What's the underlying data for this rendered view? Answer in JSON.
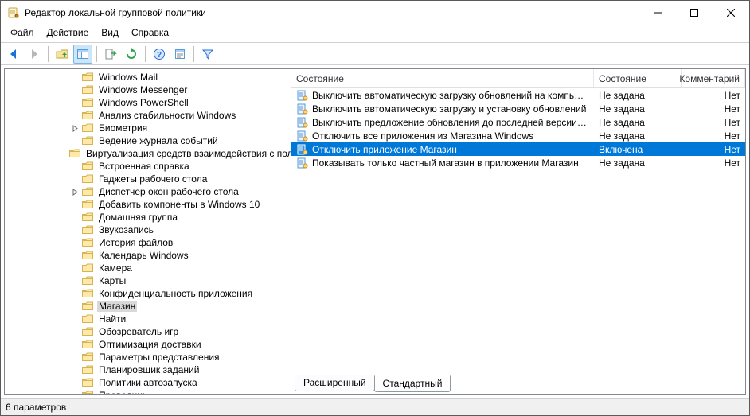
{
  "window": {
    "title": "Редактор локальной групповой политики"
  },
  "menubar": {
    "file": "Файл",
    "action": "Действие",
    "view": "Вид",
    "help": "Справка"
  },
  "tree": {
    "indent_base": 80,
    "items": [
      {
        "label": "Windows Mail",
        "expander": ""
      },
      {
        "label": "Windows Messenger",
        "expander": ""
      },
      {
        "label": "Windows PowerShell",
        "expander": ""
      },
      {
        "label": "Анализ стабильности Windows",
        "expander": ""
      },
      {
        "label": "Биометрия",
        "expander": ">"
      },
      {
        "label": "Ведение журнала событий",
        "expander": ""
      },
      {
        "label": "Виртуализация средств взаимодействия с пользователем",
        "expander": ""
      },
      {
        "label": "Встроенная справка",
        "expander": ""
      },
      {
        "label": "Гаджеты рабочего стола",
        "expander": ""
      },
      {
        "label": "Диспетчер окон рабочего стола",
        "expander": ">"
      },
      {
        "label": "Добавить компоненты в Windows 10",
        "expander": ""
      },
      {
        "label": "Домашняя группа",
        "expander": ""
      },
      {
        "label": "Звукозапись",
        "expander": ""
      },
      {
        "label": "История файлов",
        "expander": ""
      },
      {
        "label": "Календарь Windows",
        "expander": ""
      },
      {
        "label": "Камера",
        "expander": ""
      },
      {
        "label": "Карты",
        "expander": ""
      },
      {
        "label": "Конфиденциальность приложения",
        "expander": ""
      },
      {
        "label": "Магазин",
        "expander": "",
        "selected": true
      },
      {
        "label": "Найти",
        "expander": ""
      },
      {
        "label": "Обозреватель игр",
        "expander": ""
      },
      {
        "label": "Оптимизация доставки",
        "expander": ""
      },
      {
        "label": "Параметры представления",
        "expander": ""
      },
      {
        "label": "Планировщик заданий",
        "expander": ""
      },
      {
        "label": "Политики автозапуска",
        "expander": ""
      },
      {
        "label": "Проводник",
        "expander": ""
      }
    ]
  },
  "list": {
    "columns": {
      "name": "Состояние",
      "state": "Состояние",
      "comment": "Комментарий"
    },
    "rows": [
      {
        "name": "Выключить автоматическую загрузку обновлений на компьютер",
        "state": "Не задана",
        "comment": "Нет",
        "selected": false
      },
      {
        "name": "Выключить автоматическую загрузку и установку обновлений",
        "state": "Не задана",
        "comment": "Нет",
        "selected": false
      },
      {
        "name": "Выключить предложение обновления до последней версии Windows",
        "state": "Не задана",
        "comment": "Нет",
        "selected": false
      },
      {
        "name": "Отключить все приложения из Магазина Windows",
        "state": "Не задана",
        "comment": "Нет",
        "selected": false
      },
      {
        "name": "Отключить приложение Магазин",
        "state": "Включена",
        "comment": "Нет",
        "selected": true
      },
      {
        "name": "Показывать только частный магазин в приложении Магазин",
        "state": "Не задана",
        "comment": "Нет",
        "selected": false
      }
    ]
  },
  "tabs": {
    "extended": "Расширенный",
    "standard": "Стандартный"
  },
  "statusbar": {
    "text": "6 параметров"
  }
}
